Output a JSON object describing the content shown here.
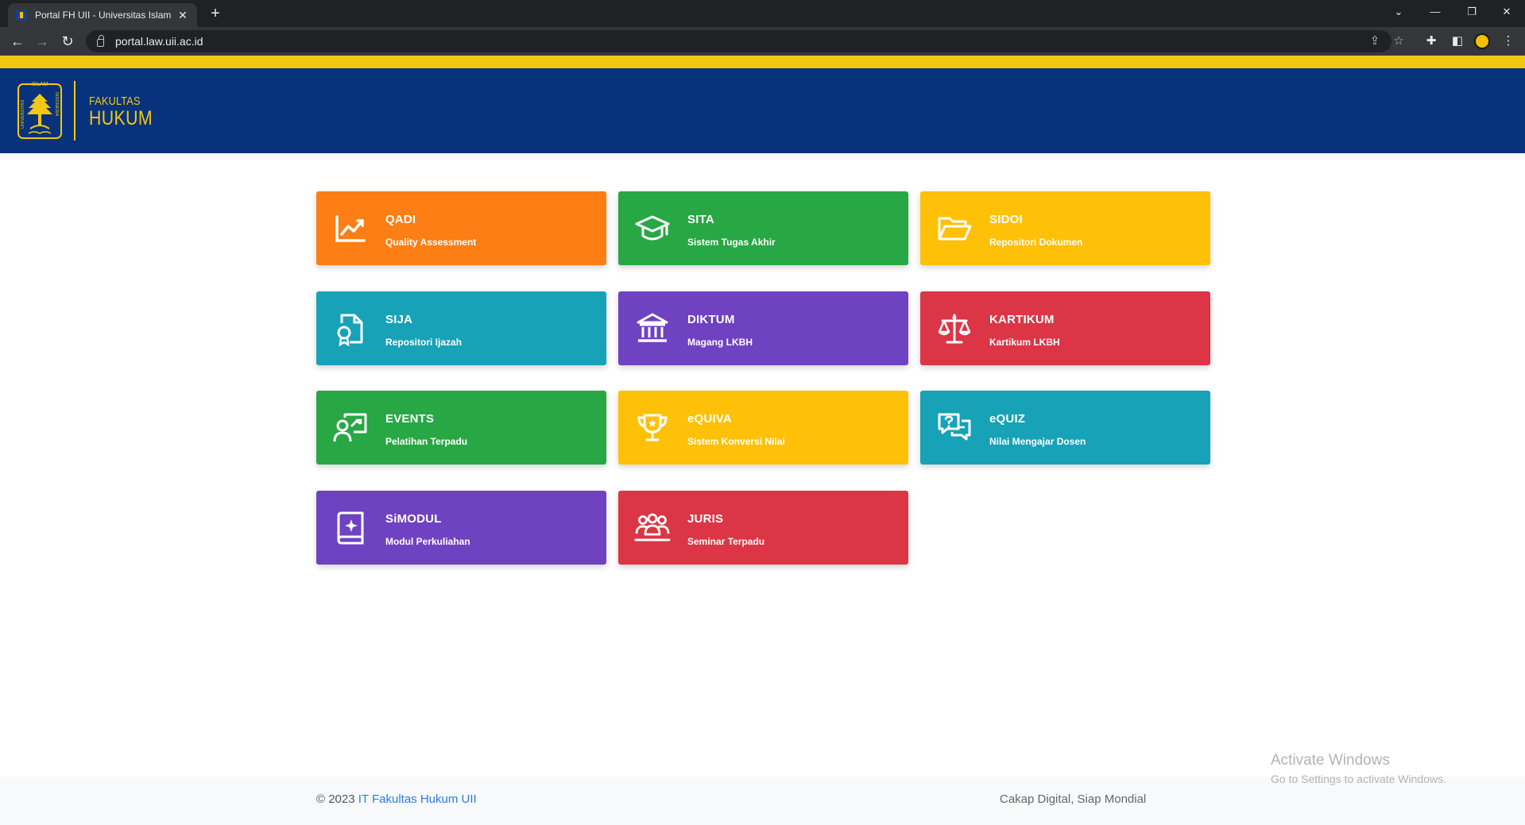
{
  "browser": {
    "tab_title": "Portal FH UII - Universitas Islam I",
    "url": "portal.law.uii.ac.id",
    "new_tab": "+",
    "close_tab": "✕"
  },
  "header": {
    "seal_top": "ISLAM",
    "seal_left": "UNIVERSITAS",
    "seal_right": "INDONESIA",
    "faculty_small": "FAKULTAS",
    "faculty_big": "HUKUM"
  },
  "apps": [
    {
      "name": "QADI",
      "desc": "Quality Assessment",
      "color": "#fd7e14",
      "icon": "chart-line-icon"
    },
    {
      "name": "SITA",
      "desc": "Sistem Tugas Akhir",
      "color": "#28a745",
      "icon": "graduation-cap-icon"
    },
    {
      "name": "SIDOI",
      "desc": "Repositori Dokumen",
      "color": "#ffc107",
      "icon": "folder-open-icon"
    },
    {
      "name": "SIJA",
      "desc": "Repositori Ijazah",
      "color": "#17a2b8",
      "icon": "certificate-file-icon"
    },
    {
      "name": "DIKTUM",
      "desc": "Magang LKBH",
      "color": "#6f42c1",
      "icon": "institution-icon"
    },
    {
      "name": "KARTIKUM",
      "desc": "Kartikum LKBH",
      "color": "#dc3545",
      "icon": "scale-balance-icon"
    },
    {
      "name": "EVENTS",
      "desc": "Pelatihan Terpadu",
      "color": "#28a745",
      "icon": "presentation-icon"
    },
    {
      "name": "eQUIVA",
      "desc": "Sistem Konversi Nilai",
      "color": "#ffc107",
      "icon": "trophy-icon"
    },
    {
      "name": "eQUIZ",
      "desc": "Nilai Mengajar Dosen",
      "color": "#17a2b8",
      "icon": "chat-question-icon"
    },
    {
      "name": "SiMODUL",
      "desc": "Modul Perkuliahan",
      "color": "#6f42c1",
      "icon": "book-sparkle-icon"
    },
    {
      "name": "JURIS",
      "desc": "Seminar Terpadu",
      "color": "#dc3545",
      "icon": "people-group-icon"
    }
  ],
  "footer": {
    "copyright_prefix": "© 2023 ",
    "copyright_link": "IT Fakultas Hukum UII",
    "slogan": "Cakap Digital, Siap Mondial"
  },
  "watermark": {
    "title": "Activate Windows",
    "subtitle": "Go to Settings to activate Windows."
  }
}
